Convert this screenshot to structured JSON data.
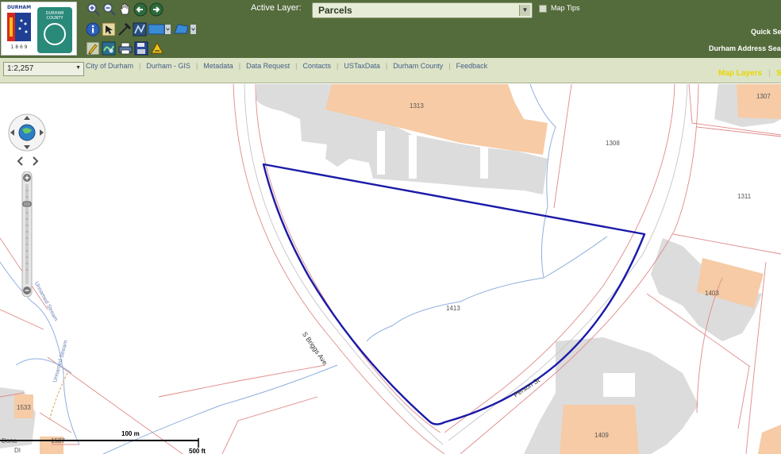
{
  "header": {
    "logo_durham_text": "DURHAM",
    "logo_durham_year": "1 8 6 9",
    "logo_county_text": "DURHAM COUNTY",
    "active_layer_label": "Active Layer:",
    "active_layer_value": "Parcels",
    "map_tips_label": "Map Tips",
    "quick_search_label": "Quick Se",
    "address_search_label": "Durham Address Sea"
  },
  "toolbar": {
    "row1": [
      "zoom-in-icon",
      "zoom-out-icon",
      "pan-hand-icon",
      "previous-extent-icon",
      "next-extent-icon"
    ],
    "row2": [
      "identify-icon",
      "select-icon",
      "measure-icon",
      "draw-line-icon",
      "draw-rectangle-icon",
      "draw-polygon-icon"
    ],
    "row3": [
      "pencil-icon",
      "overview-map-icon",
      "print-icon",
      "save-icon",
      "clear-icon"
    ]
  },
  "navbar": {
    "scale_value": "1:2,257",
    "links": [
      "City of Durham",
      "Durham - GIS",
      "Metadata",
      "Data Request",
      "Contacts",
      "USTaxData",
      "Durham County",
      "Feedback"
    ],
    "map_layers_label": "Map Layers",
    "map_layers_next": "S"
  },
  "map": {
    "parcel_labels": [
      "1313",
      "1307",
      "1308",
      "1311",
      "1403",
      "1413",
      "1409",
      "1533",
      "1537"
    ],
    "street_labels": [
      "S Briggs Ave",
      "Person St"
    ],
    "stream_labels": [
      "Unnamed Stream",
      "Unnamed Stream"
    ],
    "partial_label": "Dona",
    "partial_label_2": "DI",
    "scale_top": "100 m",
    "scale_bottom": "500 ft"
  }
}
